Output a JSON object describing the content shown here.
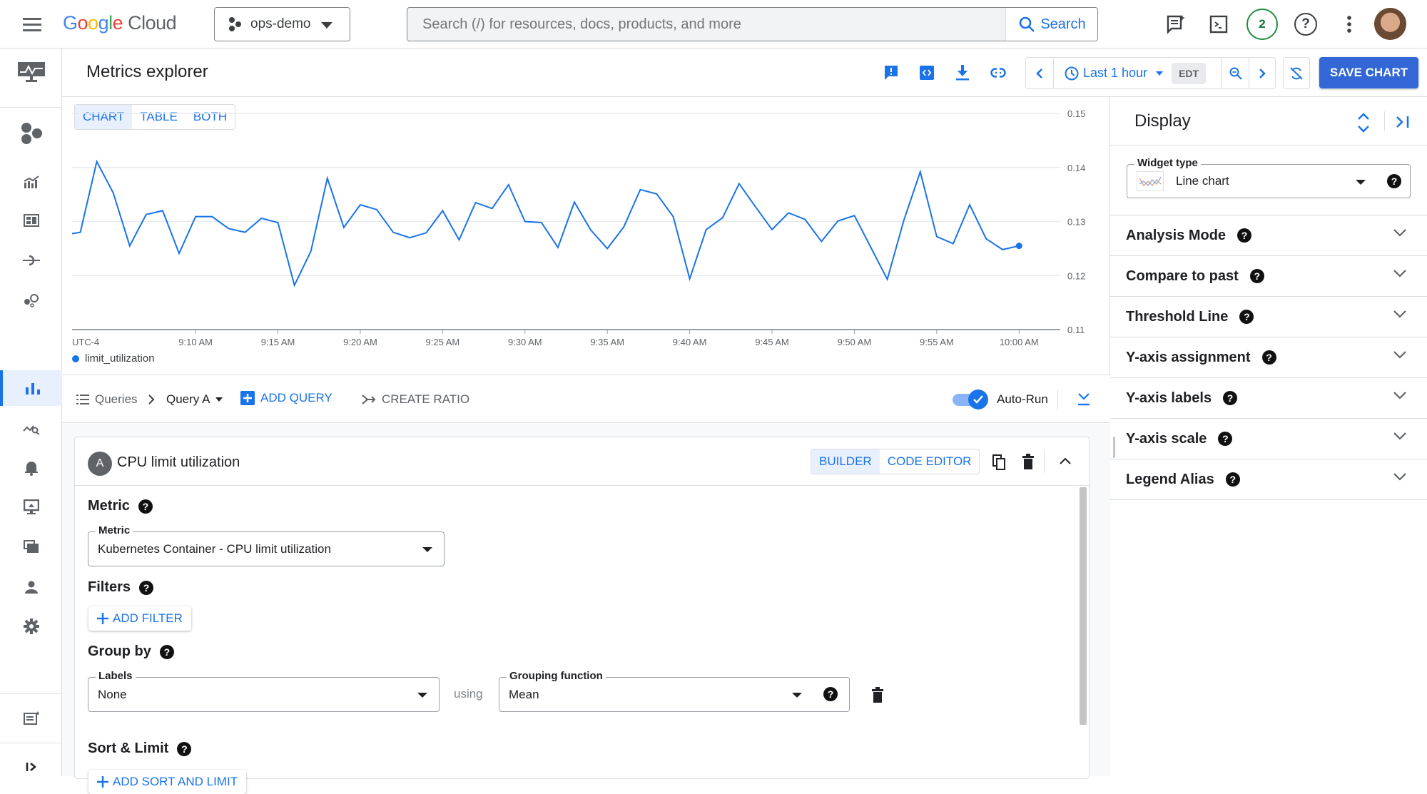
{
  "topbar": {
    "logo": "Google Cloud",
    "project": "ops-demo",
    "search_placeholder": "Search (/) for resources, docs, products, and more",
    "search_button": "Search",
    "notifications_count": "2"
  },
  "nav": {
    "items": [
      "monitoring",
      "overview",
      "dashboards",
      "services",
      "integrations",
      "metrics-explorer",
      "logs-explorer",
      "alerting",
      "uptime-checks",
      "synthetic-monitoring",
      "groups",
      "settings"
    ],
    "active": "metrics-explorer"
  },
  "header": {
    "title": "Metrics explorer",
    "time_range": "Last 1 hour",
    "timezone": "EDT",
    "save_button": "SAVE CHART"
  },
  "chart_view": {
    "tabs": [
      "CHART",
      "TABLE",
      "BOTH"
    ],
    "active": "CHART"
  },
  "chart_data": {
    "type": "line",
    "timezone_label": "UTC-4",
    "x_ticks": [
      "9:10 AM",
      "9:15 AM",
      "9:20 AM",
      "9:25 AM",
      "9:30 AM",
      "9:35 AM",
      "9:40 AM",
      "9:45 AM",
      "9:50 AM",
      "9:55 AM",
      "10:00 AM"
    ],
    "y_ticks": [
      "0.15",
      "0.14",
      "0.13",
      "0.12",
      "0.11"
    ],
    "xlim": [
      "9:02:30",
      "10:02:30"
    ],
    "ylim": [
      0.11,
      0.15
    ],
    "grid": true,
    "legend_position": "bottom-left",
    "series": [
      {
        "name": "limit_utilization",
        "color": "#1a73e8",
        "x": [
          "9:02",
          "9:03",
          "9:04",
          "9:05",
          "9:06",
          "9:07",
          "9:08",
          "9:09",
          "9:10",
          "9:11",
          "9:12",
          "9:13",
          "9:14",
          "9:15",
          "9:16",
          "9:17",
          "9:18",
          "9:19",
          "9:20",
          "9:21",
          "9:22",
          "9:23",
          "9:24",
          "9:25",
          "9:26",
          "9:27",
          "9:28",
          "9:29",
          "9:30",
          "9:31",
          "9:32",
          "9:33",
          "9:34",
          "9:35",
          "9:36",
          "9:37",
          "9:38",
          "9:39",
          "9:40",
          "9:41",
          "9:42",
          "9:43",
          "9:44",
          "9:45",
          "9:46",
          "9:47",
          "9:48",
          "9:49",
          "9:50",
          "9:51",
          "9:52",
          "9:53",
          "9:54",
          "9:55",
          "9:56",
          "9:57",
          "9:58",
          "9:59",
          "10:00"
        ],
        "values": [
          0.1275,
          0.128,
          0.1411,
          0.1353,
          0.1255,
          0.1313,
          0.132,
          0.1241,
          0.1309,
          0.1309,
          0.1287,
          0.128,
          0.1306,
          0.1298,
          0.1182,
          0.1245,
          0.138,
          0.1289,
          0.1331,
          0.1322,
          0.128,
          0.127,
          0.1279,
          0.132,
          0.1266,
          0.1335,
          0.1324,
          0.1368,
          0.13,
          0.1298,
          0.1252,
          0.1336,
          0.1284,
          0.125,
          0.129,
          0.1359,
          0.1351,
          0.1309,
          0.1194,
          0.1285,
          0.1307,
          0.137,
          0.1327,
          0.1285,
          0.1316,
          0.1304,
          0.1263,
          0.1301,
          0.1311,
          0.1252,
          0.1193,
          0.1302,
          0.1392,
          0.1272,
          0.1259,
          0.1331,
          0.1268,
          0.1248,
          0.1255
        ]
      }
    ]
  },
  "querybar": {
    "queries": "Queries",
    "current_query": "Query A",
    "add_query": "ADD QUERY",
    "create_ratio": "CREATE RATIO",
    "auto_run": "Auto-Run",
    "auto_run_on": true
  },
  "query": {
    "letter": "A",
    "title": "CPU limit utilization",
    "modes": [
      "BUILDER",
      "CODE EDITOR"
    ],
    "active_mode": "BUILDER",
    "metric_heading": "Metric",
    "metric_label": "Metric",
    "metric_value": "Kubernetes Container - CPU limit utilization",
    "filters_heading": "Filters",
    "add_filter": "ADD FILTER",
    "groupby_heading": "Group by",
    "labels_label": "Labels",
    "labels_value": "None",
    "using": "using",
    "grouping_label": "Grouping function",
    "grouping_value": "Mean",
    "sort_heading": "Sort & Limit",
    "add_sort": "ADD SORT AND LIMIT"
  },
  "display": {
    "title": "Display",
    "widget_type_label": "Widget type",
    "widget_type_value": "Line chart",
    "sections": [
      "Analysis Mode",
      "Compare to past",
      "Threshold Line",
      "Y-axis assignment",
      "Y-axis labels",
      "Y-axis scale",
      "Legend Alias"
    ]
  }
}
